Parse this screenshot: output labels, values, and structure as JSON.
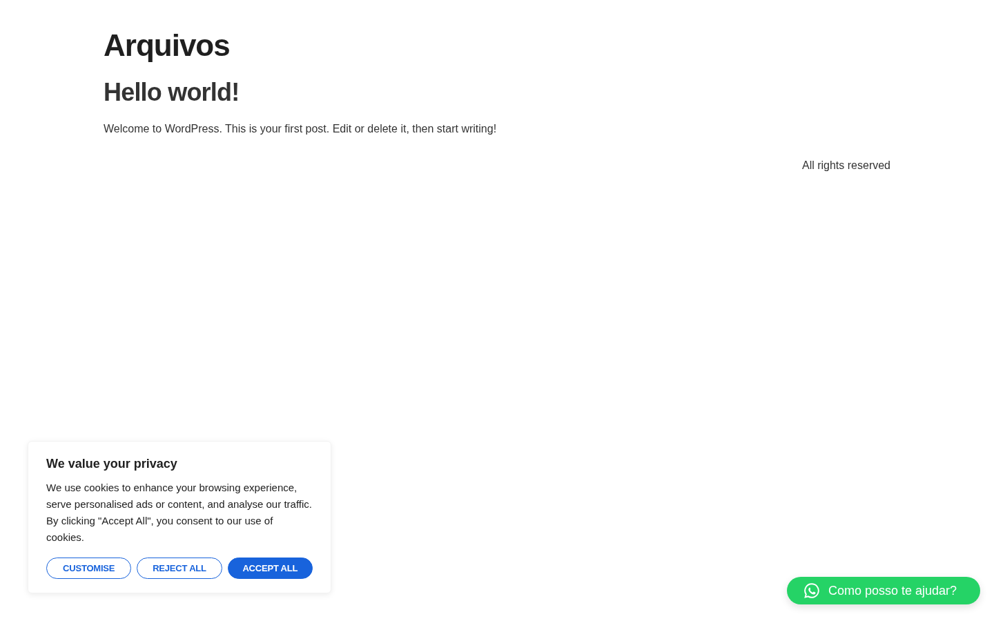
{
  "page_title": "Arquivos",
  "posts": [
    {
      "title": "Hello world!",
      "excerpt": "Welcome to WordPress. This is your first post. Edit or delete it, then start writing!"
    }
  ],
  "footer": {
    "text": "All rights reserved"
  },
  "cookie_banner": {
    "title": "We value your privacy",
    "text": "We use cookies to enhance your browsing experience, serve personalised ads or content, and analyse our traffic. By clicking \"Accept All\", you consent to our use of cookies.",
    "buttons": [
      {
        "label": "CUSTOMISE",
        "kind": "outline"
      },
      {
        "label": "REJECT ALL",
        "kind": "outline"
      },
      {
        "label": "ACCEPT ALL",
        "kind": "filled"
      }
    ]
  },
  "chat_button": {
    "label": "Como posso te ajudar?"
  }
}
